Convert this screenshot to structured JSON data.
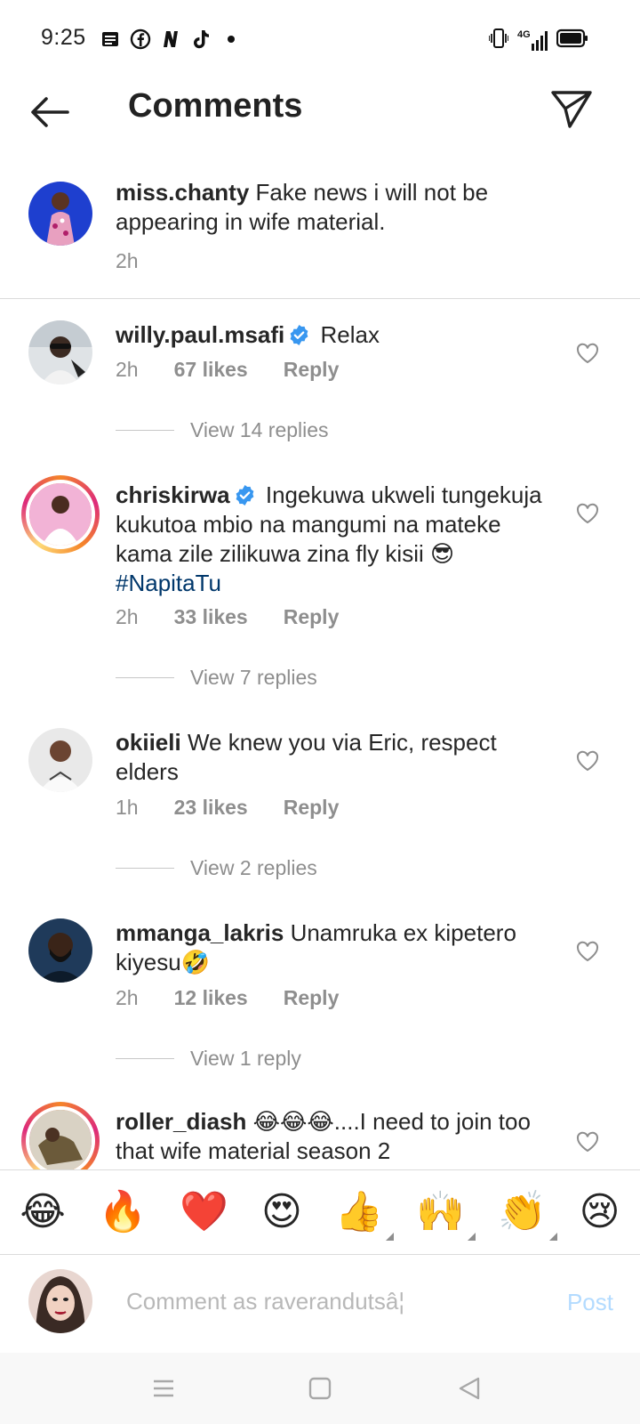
{
  "status_bar": {
    "time": "9:25",
    "left_icons": [
      "news-icon",
      "facebook-icon",
      "netflix-n-icon",
      "tiktok-icon",
      "dot-icon"
    ],
    "network": "4G",
    "right_icons": [
      "vibrate-icon",
      "signal-icon",
      "battery-icon"
    ]
  },
  "header": {
    "title": "Comments",
    "back_icon": "arrow-left-icon",
    "send_icon": "send-icon"
  },
  "caption": {
    "username": "miss.chanty",
    "text": "Fake news i will not be appearing in wife material.",
    "time": "2h"
  },
  "comments": [
    {
      "username": "willy.paul.msafi",
      "verified": true,
      "text": "Relax",
      "time": "2h",
      "likes": "67 likes",
      "reply_label": "Reply",
      "view_replies": "View 14 replies"
    },
    {
      "username": "chriskirwa",
      "verified": true,
      "text": "Ingekuwa ukweli tungekuja kukutoa mbio na mangumi na mateke kama zile zilikuwa zina fly kisii 😎",
      "hashtag": "#NapitaTu",
      "time": "2h",
      "likes": "33 likes",
      "reply_label": "Reply",
      "view_replies": "View 7 replies"
    },
    {
      "username": "okiieli",
      "verified": false,
      "text": "We knew you via Eric, respect elders",
      "time": "1h",
      "likes": "23 likes",
      "reply_label": "Reply",
      "view_replies": "View 2 replies"
    },
    {
      "username": "mmanga_lakris",
      "verified": false,
      "text": "Unamruka ex kipetero kiyesu🤣",
      "time": "2h",
      "likes": "12 likes",
      "reply_label": "Reply",
      "view_replies": "View 1 reply"
    },
    {
      "username": "roller_diash",
      "verified": false,
      "text": "😂😂😂....I need to join too that wife material season 2"
    }
  ],
  "emoji_bar": [
    {
      "glyph": "😂",
      "name": "tears-of-joy"
    },
    {
      "glyph": "🔥",
      "name": "fire"
    },
    {
      "glyph": "❤️",
      "name": "red-heart"
    },
    {
      "glyph": "😍",
      "name": "heart-eyes"
    },
    {
      "glyph": "👍",
      "name": "thumbs-up"
    },
    {
      "glyph": "🙌",
      "name": "raising-hands"
    },
    {
      "glyph": "👏",
      "name": "clapping-hands"
    },
    {
      "glyph": "😢",
      "name": "crying-face"
    }
  ],
  "input": {
    "placeholder": "Comment as raverandutsâ¦",
    "value": "",
    "post_label": "Post"
  },
  "colors": {
    "verified_blue": "#3897f0",
    "hashtag": "#00376b",
    "post_disabled": "#b3dbff",
    "meta_gray": "#8e8e8e"
  }
}
